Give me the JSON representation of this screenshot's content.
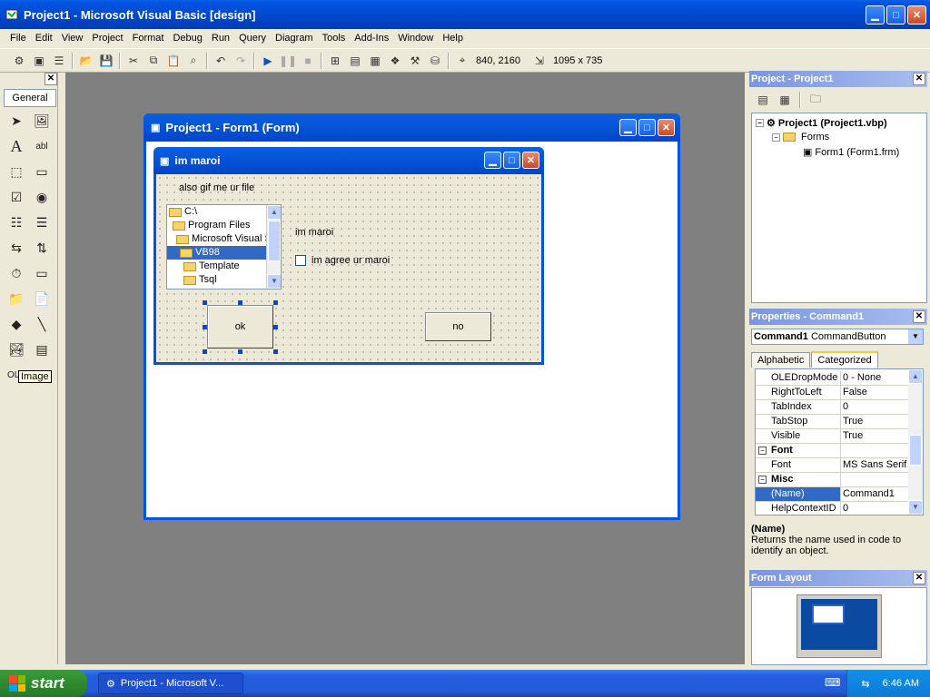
{
  "window": {
    "title": "Project1 - Microsoft Visual Basic [design]"
  },
  "menu": [
    "File",
    "Edit",
    "View",
    "Project",
    "Format",
    "Debug",
    "Run",
    "Query",
    "Diagram",
    "Tools",
    "Add-Ins",
    "Window",
    "Help"
  ],
  "toolbar": {
    "position_readout": "840, 2160",
    "size_readout": "1095 x 735"
  },
  "toolbox": {
    "tab_label": "General",
    "tooltip": "Image"
  },
  "form_designer": {
    "title": "Project1 - Form1 (Form)"
  },
  "designed_form": {
    "title": "im maroi",
    "file_label": "also gif me ur file",
    "dir_items": [
      {
        "label": "C:\\"
      },
      {
        "label": "Program Files"
      },
      {
        "label": "Microsoft Visual S"
      },
      {
        "label": "VB98"
      },
      {
        "label": "Template"
      },
      {
        "label": "Tsql"
      }
    ],
    "label_maroi": "im maroi",
    "checkbox_label": "im agree ur maroi",
    "ok_button": "ok",
    "no_button": "no"
  },
  "project_panel": {
    "title": "Project - Project1",
    "tree": {
      "project": "Project1 (Project1.vbp)",
      "forms_folder": "Forms",
      "form": "Form1 (Form1.frm)"
    }
  },
  "properties_panel": {
    "title": "Properties - Command1",
    "object_name": "Command1",
    "object_type": "CommandButton",
    "tabs": [
      "Alphabetic",
      "Categorized"
    ],
    "rows": [
      {
        "key": "OLEDropMode",
        "value": "0 - None"
      },
      {
        "key": "RightToLeft",
        "value": "False"
      },
      {
        "key": "TabIndex",
        "value": "0"
      },
      {
        "key": "TabStop",
        "value": "True"
      },
      {
        "key": "Visible",
        "value": "True"
      },
      {
        "key": "Font",
        "value": ""
      },
      {
        "key": "Font",
        "value": "MS Sans Serif"
      },
      {
        "key": "Misc",
        "value": ""
      },
      {
        "key": "(Name)",
        "value": "Command1"
      },
      {
        "key": "HelpContextID",
        "value": "0"
      }
    ],
    "desc_name": "(Name)",
    "desc_text": "Returns the name used in code to identify an object."
  },
  "layout_panel": {
    "title": "Form Layout"
  },
  "taskbar": {
    "start_label": "start",
    "task_label": "Project1 - Microsoft V...",
    "clock": "6:46 AM"
  },
  "colors": {
    "xp_blue": "#0054e3",
    "selection": "#316ac5",
    "mdi_gray": "#808080"
  }
}
